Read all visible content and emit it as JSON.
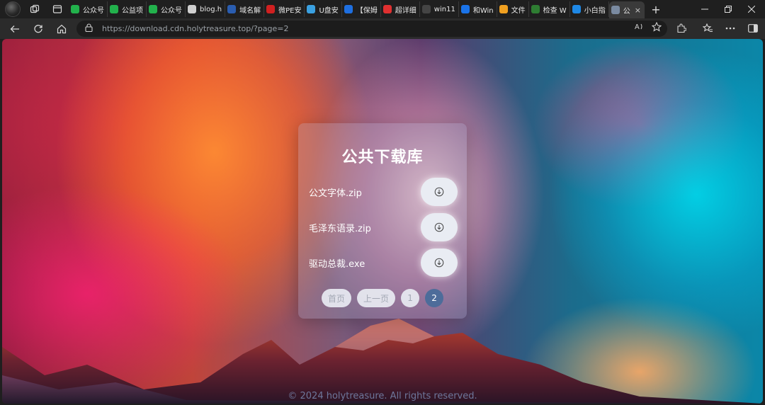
{
  "browser": {
    "tabs": [
      {
        "label": "公众号",
        "icon_color": "#22b14c"
      },
      {
        "label": "公益项",
        "icon_color": "#22b14c"
      },
      {
        "label": "公众号",
        "icon_color": "#22b14c"
      },
      {
        "label": "blog.h",
        "icon_color": "#cfcfcf"
      },
      {
        "label": "域名解",
        "icon_color": "#2a5db0"
      },
      {
        "label": "微PE安",
        "icon_color": "#d02020"
      },
      {
        "label": "U盘安",
        "icon_color": "#3aa0e0"
      },
      {
        "label": "【保姆",
        "icon_color": "#1e6fe0"
      },
      {
        "label": "超详细",
        "icon_color": "#e03030"
      },
      {
        "label": "win11",
        "icon_color": "#444444"
      },
      {
        "label": "和Win",
        "icon_color": "#1a73e8"
      },
      {
        "label": "文件",
        "icon_color": "#f0a020"
      },
      {
        "label": "检查 W",
        "icon_color": "#2e7d32"
      },
      {
        "label": "小白指",
        "icon_color": "#1e88e5"
      },
      {
        "label": "公",
        "icon_color": "#7a8aa0",
        "active": true,
        "close": "×"
      }
    ],
    "new_tab_label": "+",
    "url": "https://download.cdn.holytreasure.top/?page=2"
  },
  "page": {
    "title": "公共下载库",
    "files": [
      {
        "name": "公文字体.zip"
      },
      {
        "name": "毛泽东语录.zip"
      },
      {
        "name": "驱动总裁.exe"
      }
    ],
    "pagination": {
      "first": "首页",
      "prev": "上一页",
      "pages": [
        "1",
        "2"
      ],
      "current": "2"
    },
    "footer": "© 2024 holytreasure. All rights reserved."
  }
}
